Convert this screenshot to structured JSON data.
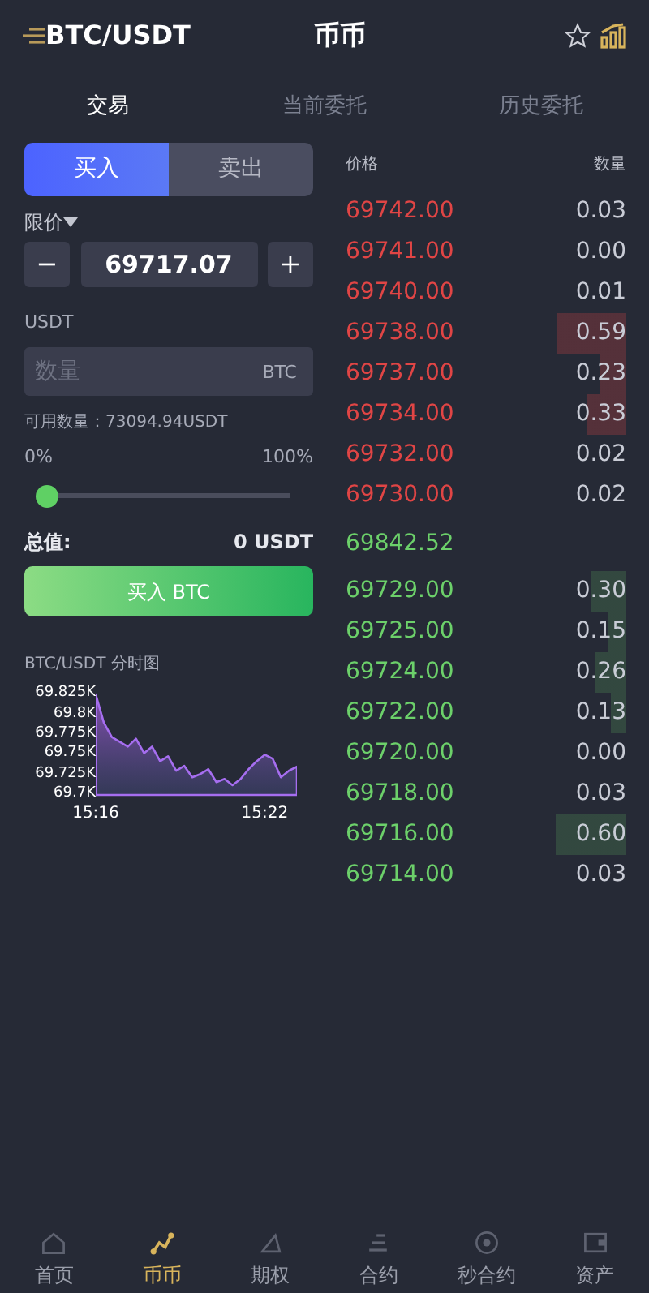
{
  "header": {
    "pair": "BTC/USDT",
    "title": "币币",
    "favorite": false
  },
  "tabs": [
    {
      "label": "交易",
      "selected": true
    },
    {
      "label": "当前委托",
      "selected": false
    },
    {
      "label": "历史委托",
      "selected": false
    }
  ],
  "side_toggle": [
    {
      "label": "买入",
      "selected": true
    },
    {
      "label": "卖出",
      "selected": false
    }
  ],
  "order_type": "限价",
  "price": {
    "minus": "−",
    "value": "69717.07",
    "plus": "+",
    "unit": "USDT"
  },
  "amount": {
    "placeholder": "数量",
    "unit": "BTC"
  },
  "available": "可用数量：73094.94USDT",
  "slider": {
    "min_label": "0%",
    "max_label": "100%",
    "level": 0
  },
  "total": {
    "label": "总值:",
    "value": "0 USDT"
  },
  "submit": "买入 BTC",
  "chart": {
    "title": "BTC/USDT 分时图",
    "chart_data": {
      "type": "area",
      "categories": [
        "15:16",
        null,
        null,
        null,
        null,
        null,
        null,
        null,
        null,
        null,
        null,
        null,
        null,
        null,
        null,
        null,
        null,
        null,
        null,
        null,
        null,
        "15:22",
        null,
        null,
        null,
        null
      ],
      "values": [
        69.825,
        69.79,
        69.772,
        69.766,
        69.76,
        69.77,
        69.752,
        69.76,
        69.742,
        69.748,
        69.73,
        69.736,
        69.722,
        69.726,
        69.732,
        69.716,
        69.72,
        69.712,
        69.72,
        69.732,
        69.742,
        69.75,
        69.745,
        69.722,
        69.73,
        69.735
      ],
      "ylim": [
        69.7,
        69.825
      ],
      "yticks": [
        {
          "value": 69.825,
          "label": "69.825K"
        },
        {
          "value": 69.8,
          "label": "69.8K"
        },
        {
          "value": 69.775,
          "label": "69.775K"
        },
        {
          "value": 69.75,
          "label": "69.75K"
        },
        {
          "value": 69.725,
          "label": "69.725K"
        },
        {
          "value": 69.7,
          "label": "69.7K"
        }
      ]
    }
  },
  "order_book": {
    "price_header": "价格",
    "amount_header": "数量",
    "asks": [
      {
        "price": "69742.00",
        "amount": "0.03"
      },
      {
        "price": "69741.00",
        "amount": "0.00"
      },
      {
        "price": "69740.00",
        "amount": "0.01"
      },
      {
        "price": "69738.00",
        "amount": "0.59"
      },
      {
        "price": "69737.00",
        "amount": "0.23"
      },
      {
        "price": "69734.00",
        "amount": "0.33"
      },
      {
        "price": "69732.00",
        "amount": "0.02"
      },
      {
        "price": "69730.00",
        "amount": "0.02"
      }
    ],
    "last_price": "69842.52",
    "bids": [
      {
        "price": "69729.00",
        "amount": "0.30"
      },
      {
        "price": "69725.00",
        "amount": "0.15"
      },
      {
        "price": "69724.00",
        "amount": "0.26"
      },
      {
        "price": "69722.00",
        "amount": "0.13"
      },
      {
        "price": "69720.00",
        "amount": "0.00"
      },
      {
        "price": "69718.00",
        "amount": "0.03"
      },
      {
        "price": "69716.00",
        "amount": "0.60"
      },
      {
        "price": "69714.00",
        "amount": "0.03"
      }
    ]
  },
  "bottom_nav": [
    {
      "label": "首页",
      "kind": "home",
      "selected": false
    },
    {
      "label": "币币",
      "kind": "spot",
      "selected": true
    },
    {
      "label": "期权",
      "kind": "options",
      "selected": false
    },
    {
      "label": "合约",
      "kind": "contract",
      "selected": false
    },
    {
      "label": "秒合约",
      "kind": "second",
      "selected": false
    },
    {
      "label": "资产",
      "kind": "assets",
      "selected": false
    }
  ]
}
